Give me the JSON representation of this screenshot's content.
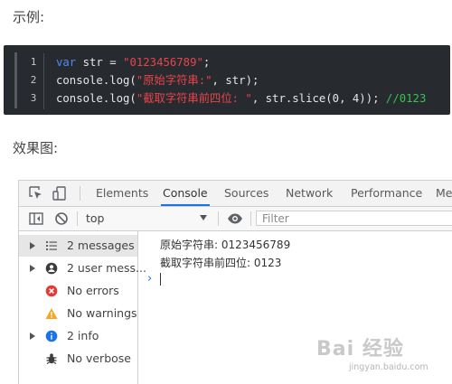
{
  "headings": {
    "example": "示例:",
    "result": "效果图:"
  },
  "code": {
    "line_numbers": [
      "1",
      "2",
      "3"
    ],
    "line1": {
      "kw": "var",
      "mid": " str = ",
      "str": "\"0123456789\"",
      "end": ";"
    },
    "line2": {
      "pre": "console.log(",
      "str": "\"原始字符串:\"",
      "end": ", str);"
    },
    "line3": {
      "pre": "console.log(",
      "str": "\"截取字符串前四位: \"",
      "mid": ", str.slice(0, 4)); ",
      "cmt": "//0123"
    }
  },
  "devtools": {
    "tabs": [
      "Elements",
      "Console",
      "Sources",
      "Network",
      "Performance",
      "Me"
    ],
    "active_tab": "Console",
    "context": "top",
    "filter_placeholder": "Filter",
    "sidebar": [
      {
        "label": "2 messages",
        "icon": "list-icon",
        "expandable": true,
        "selected": true
      },
      {
        "label": "2 user mess...",
        "icon": "user-icon",
        "expandable": true
      },
      {
        "label": "No errors",
        "icon": "error-icon",
        "color": "#e53935"
      },
      {
        "label": "No warnings",
        "icon": "warning-icon",
        "color": "#f5a623"
      },
      {
        "label": "2 info",
        "icon": "info-icon",
        "expandable": true,
        "color": "#1a73e8"
      },
      {
        "label": "No verbose",
        "icon": "bug-icon"
      }
    ],
    "messages": [
      "原始字符串: 0123456789",
      "截取字符串前四位: 0123"
    ]
  },
  "watermark": {
    "logo": "Bai 经验",
    "url": "jingyan.baidu.com"
  }
}
